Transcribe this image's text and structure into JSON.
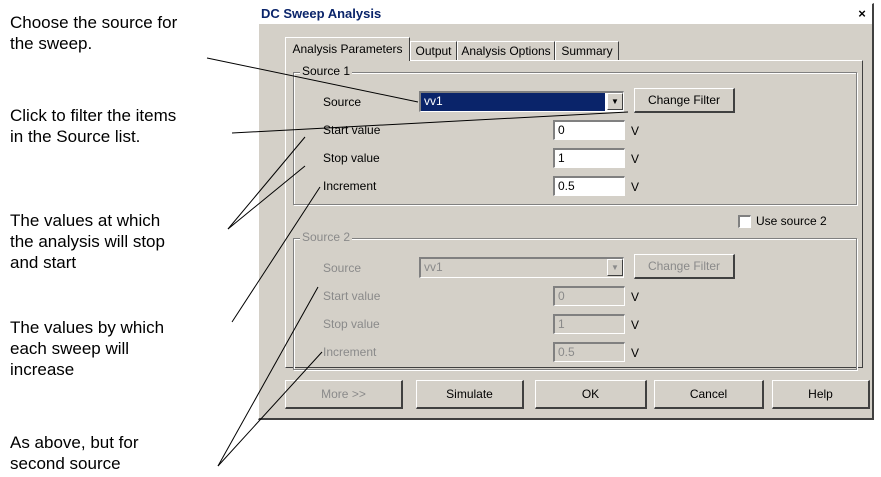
{
  "annotations": {
    "choose_source": [
      "Choose the source for",
      "the sweep."
    ],
    "filter": [
      "Click to filter the items",
      "in the Source list."
    ],
    "stop_start": [
      "The values at which",
      "the analysis will stop",
      "and start"
    ],
    "increment": [
      "The values by which",
      "each sweep will",
      "increase"
    ],
    "second_source": [
      "As above, but for",
      "second source"
    ]
  },
  "dialog": {
    "title": "DC Sweep Analysis",
    "close_glyph": "×",
    "tabs": [
      "Analysis Parameters",
      "Output",
      "Analysis Options",
      "Summary"
    ],
    "source1": {
      "group_label": "Source 1",
      "source_label": "Source",
      "source_value": "vv1",
      "change_filter": "Change Filter",
      "start_label": "Start value",
      "start_value": "0",
      "stop_label": "Stop value",
      "stop_value": "1",
      "increment_label": "Increment",
      "increment_value": "0.5",
      "unit": "V"
    },
    "use_source2": "Use source 2",
    "source2": {
      "group_label": "Source 2",
      "source_label": "Source",
      "source_value": "vv1",
      "change_filter": "Change Filter",
      "start_label": "Start value",
      "start_value": "0",
      "stop_label": "Stop value",
      "stop_value": "1",
      "increment_label": "Increment",
      "increment_value": "0.5",
      "unit": "V"
    },
    "buttons": {
      "more": "More >>",
      "simulate": "Simulate",
      "ok": "OK",
      "cancel": "Cancel",
      "help": "Help"
    }
  }
}
